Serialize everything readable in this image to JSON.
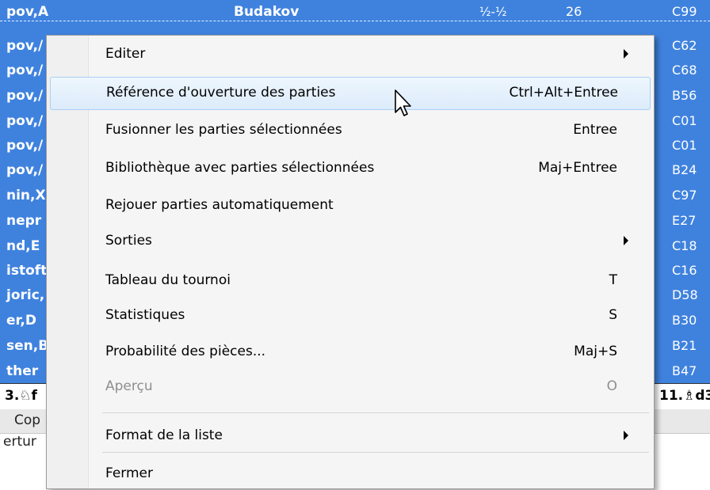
{
  "list": {
    "rows": [
      {
        "player": "pov,A",
        "white2": "Budakov",
        "result": "½-½",
        "moves": "26",
        "eco": "C99"
      },
      {
        "player": "pov,/",
        "white2": "",
        "result": "",
        "moves": "",
        "eco": "C62"
      },
      {
        "player": "pov,/",
        "white2": "",
        "result": "",
        "moves": "",
        "eco": "C68"
      },
      {
        "player": "pov,/",
        "white2": "",
        "result": "",
        "moves": "",
        "eco": "B56"
      },
      {
        "player": "pov,/",
        "white2": "",
        "result": "",
        "moves": "",
        "eco": "C01"
      },
      {
        "player": "pov,/",
        "white2": "",
        "result": "",
        "moves": "",
        "eco": "C01"
      },
      {
        "player": "pov,/",
        "white2": "",
        "result": "",
        "moves": "",
        "eco": "B24"
      },
      {
        "player": "nin,X",
        "white2": "",
        "result": "",
        "moves": "",
        "eco": "C97"
      },
      {
        "player": "nepr",
        "white2": "",
        "result": "",
        "moves": "",
        "eco": "E27"
      },
      {
        "player": "nd,E",
        "white2": "",
        "result": "",
        "moves": "",
        "eco": "C18"
      },
      {
        "player": "istoft",
        "white2": "",
        "result": "",
        "moves": "",
        "eco": "C16"
      },
      {
        "player": "joric,",
        "white2": "",
        "result": "",
        "moves": "",
        "eco": "D58"
      },
      {
        "player": "er,D",
        "white2": "",
        "result": "",
        "moves": "",
        "eco": "B30"
      },
      {
        "player": "sen,B",
        "white2": "",
        "result": "",
        "moves": "",
        "eco": "B21"
      },
      {
        "player": "ther",
        "white2": "",
        "result": "",
        "moves": "",
        "eco": "B47"
      }
    ],
    "moves_left": "3.♘f",
    "moves_right": "11.♗d3",
    "tab_label": "Cop",
    "status_text": "ertur"
  },
  "menu": {
    "items": [
      {
        "name": "menu-item-editer",
        "label": "Editer",
        "shortcut": "",
        "submenu": true,
        "highlighted": false,
        "disabled": false
      },
      {
        "name": "menu-item-reference-ouverture",
        "label": "Référence d'ouverture des parties",
        "shortcut": "Ctrl+Alt+Entree",
        "submenu": false,
        "highlighted": true,
        "disabled": false
      },
      {
        "name": "menu-item-fusionner",
        "label": "Fusionner les parties sélectionnées",
        "shortcut": "Entree",
        "submenu": false,
        "highlighted": false,
        "disabled": false
      },
      {
        "name": "menu-item-bibliotheque",
        "label": "Bibliothèque avec parties sélectionnées",
        "shortcut": "Maj+Entree",
        "submenu": false,
        "highlighted": false,
        "disabled": false
      },
      {
        "name": "menu-item-rejouer",
        "label": "Rejouer parties automatiquement",
        "shortcut": "",
        "submenu": false,
        "highlighted": false,
        "disabled": false
      },
      {
        "name": "menu-item-sorties",
        "label": "Sorties",
        "shortcut": "",
        "submenu": true,
        "highlighted": false,
        "disabled": false
      },
      {
        "name": "menu-item-tableau-tournoi",
        "label": "Tableau du tournoi",
        "shortcut": "T",
        "submenu": false,
        "highlighted": false,
        "disabled": false
      },
      {
        "name": "menu-item-statistiques",
        "label": "Statistiques",
        "shortcut": "S",
        "submenu": false,
        "highlighted": false,
        "disabled": false
      },
      {
        "name": "menu-item-probabilite",
        "label": "Probabilité des pièces...",
        "shortcut": "Maj+S",
        "submenu": false,
        "highlighted": false,
        "disabled": false
      },
      {
        "name": "menu-item-apercu",
        "label": "Aperçu",
        "shortcut": "O",
        "submenu": false,
        "highlighted": false,
        "disabled": true
      },
      {
        "name": "menu-item-format-liste",
        "label": "Format de la liste",
        "shortcut": "",
        "submenu": true,
        "highlighted": false,
        "disabled": false
      },
      {
        "name": "menu-item-fermer",
        "label": "Fermer",
        "shortcut": "",
        "submenu": false,
        "highlighted": false,
        "disabled": false
      }
    ]
  },
  "colors": {
    "list_selection": "#3f82de",
    "menu_background": "#f5f5f5",
    "menu_highlight": "#dcebfb",
    "disabled_text": "#8e8e8e"
  }
}
